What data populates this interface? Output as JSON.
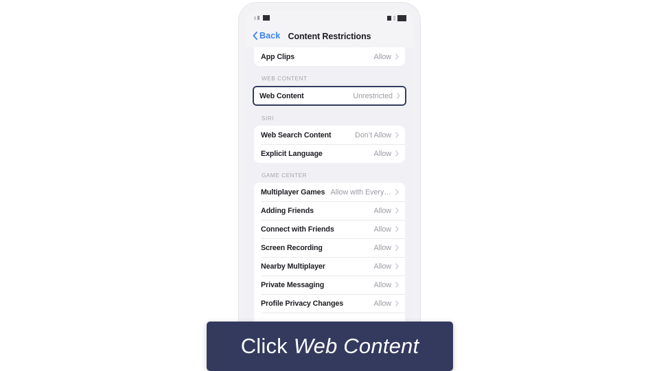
{
  "device": {
    "status_bar": {
      "left_icons": [
        "signal-bars-icon",
        "carrier-icon"
      ],
      "right_icons": [
        "wifi-icon",
        "battery-icon"
      ]
    }
  },
  "nav": {
    "back_label": "Back",
    "back_icon": "chevron-left-icon",
    "title": "Content Restrictions"
  },
  "sections": [
    {
      "id": "top-partial",
      "header": "",
      "rows": [
        {
          "label": "App Clips",
          "value": "Allow",
          "chevron": "chevron-right-icon"
        }
      ]
    },
    {
      "id": "web-content",
      "header": "WEB CONTENT",
      "rows": [
        {
          "label": "Web Content",
          "value": "Unrestricted",
          "chevron": "chevron-right-icon",
          "highlighted": true
        }
      ]
    },
    {
      "id": "siri",
      "header": "SIRI",
      "rows": [
        {
          "label": "Web Search Content",
          "value": "Don’t Allow",
          "chevron": "chevron-right-icon"
        },
        {
          "label": "Explicit Language",
          "value": "Allow",
          "chevron": "chevron-right-icon"
        }
      ]
    },
    {
      "id": "game-center",
      "header": "GAME CENTER",
      "rows": [
        {
          "label": "Multiplayer Games",
          "value": "Allow with Every…",
          "chevron": "chevron-right-icon"
        },
        {
          "label": "Adding Friends",
          "value": "Allow",
          "chevron": "chevron-right-icon"
        },
        {
          "label": "Connect with Friends",
          "value": "Allow",
          "chevron": "chevron-right-icon"
        },
        {
          "label": "Screen Recording",
          "value": "Allow",
          "chevron": "chevron-right-icon"
        },
        {
          "label": "Nearby Multiplayer",
          "value": "Allow",
          "chevron": "chevron-right-icon"
        },
        {
          "label": "Private Messaging",
          "value": "Allow",
          "chevron": "chevron-right-icon"
        },
        {
          "label": "Profile Privacy Changes",
          "value": "Allow",
          "chevron": "chevron-right-icon"
        }
      ]
    }
  ],
  "caption": {
    "prefix": "Click ",
    "target": "Web Content"
  },
  "colors": {
    "accent_blue": "#3d83f5",
    "caption_bg": "#333a5e",
    "highlight_border": "#353b5e",
    "screen_bg": "#f1f1f5",
    "row_bg": "#ffffff",
    "value_text": "#9a9aa4",
    "label_text": "#1c1c22"
  }
}
